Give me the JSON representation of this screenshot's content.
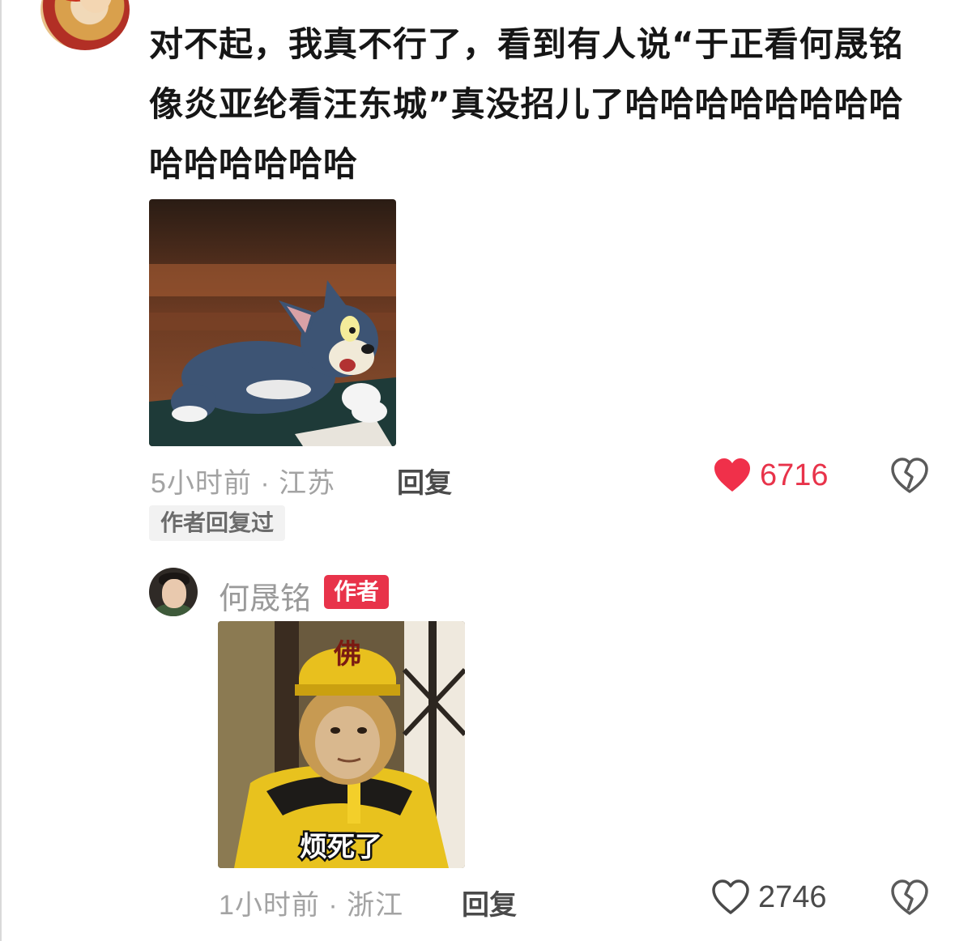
{
  "comment": {
    "text_lines": [
      "对不起，我真不行了，看到有人说“于正看何晟铭",
      "像炎亚纶看汪东城”真没招儿了哈哈哈哈哈哈哈哈",
      "哈哈哈哈哈哈"
    ],
    "meta": "5小时前 · 江苏",
    "reply_label": "回复",
    "likes": "6716",
    "liked": true,
    "badge": "作者回复过"
  },
  "reply": {
    "username": "何晟铭",
    "author_badge": "作者",
    "sticker_caption": "烦死了",
    "sticker_hat_text": "佛",
    "meta": "1小时前 · 浙江",
    "reply_label": "回复",
    "likes": "2746",
    "liked": false
  },
  "colors": {
    "accent_red": "#e8334a",
    "meta_gray": "#a3a3a3"
  },
  "icons": {
    "like_filled": "heart-filled-icon",
    "like_outline": "heart-outline-icon",
    "dislike": "broken-heart-icon"
  }
}
